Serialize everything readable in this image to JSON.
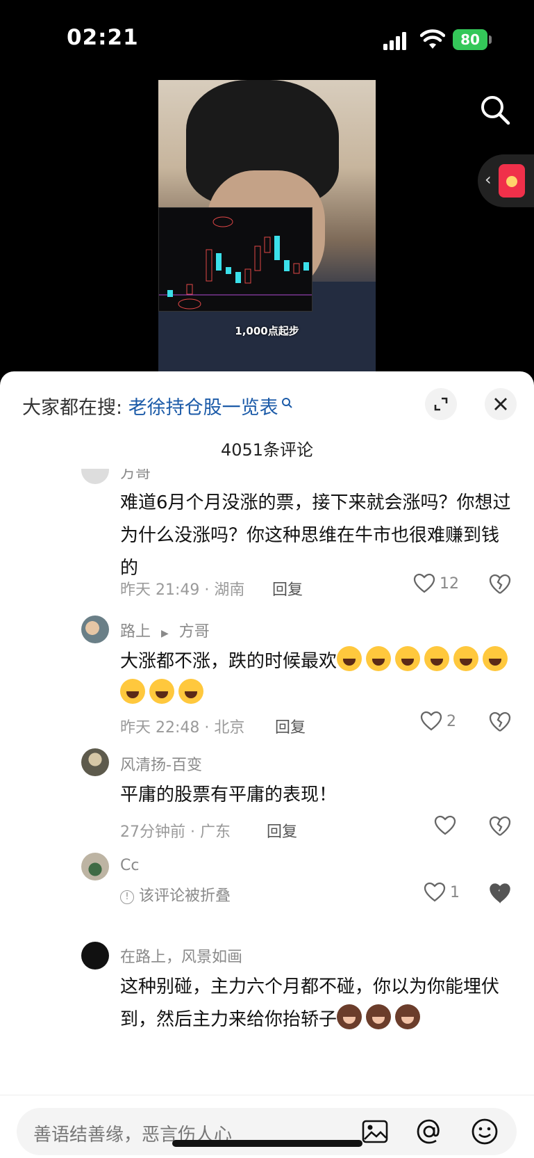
{
  "status": {
    "time": "02:21",
    "battery": "80"
  },
  "video": {
    "subtitle": "1,000点起步"
  },
  "sheet": {
    "hot_prefix": "大家都在搜: ",
    "hot_keyword": "老徐持仓股一览表",
    "comment_count": "4051条评论"
  },
  "comments": [
    {
      "name": "方哥",
      "text": "难道6月个月没涨的票，接下来就会涨吗？你想过为什么没涨吗？你这种思维在牛市也很难赚到钱的",
      "time_loc": "昨天 21:49 · 湖南",
      "reply": "回复",
      "likes": "12"
    },
    {
      "name": "路上",
      "reply_to": "方哥",
      "text": "大涨都不涨，跌的时候最欢",
      "time_loc": "昨天 22:48 · 北京",
      "reply": "回复",
      "likes": "2"
    },
    {
      "name": "风清扬-百变",
      "text": "平庸的股票有平庸的表现！",
      "time_loc": "27分钟前 · 广东",
      "reply": "回复",
      "likes": ""
    },
    {
      "name": "Cc",
      "folded": "该评论被折叠",
      "likes": "1"
    },
    {
      "name": "在路上，风景如画",
      "text": "这种别碰，主力六个月都不碰，你以为你能埋伏到，然后主力来给你抬轿子"
    }
  ],
  "input": {
    "placeholder": "善语结善缘，恶言伤人心"
  },
  "icons": [
    "search-icon",
    "red-packet-icon",
    "expand-icon",
    "close-icon",
    "heart-icon",
    "dislike-heart-icon",
    "image-icon",
    "at-icon",
    "emoji-icon"
  ]
}
